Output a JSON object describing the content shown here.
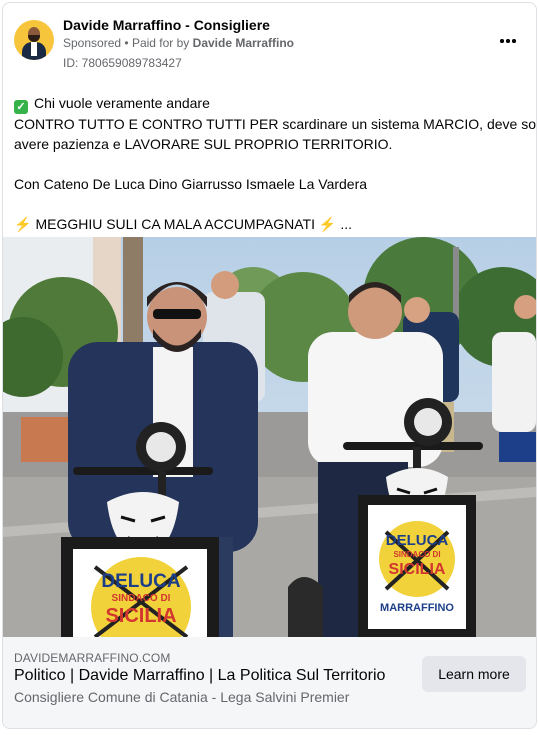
{
  "advertiser": {
    "name": "Davide Marraffino - Consigliere",
    "sponsored_label": "Sponsored",
    "paid_for_prefix": "Paid for by",
    "paid_for_name": "Davide Marraffino",
    "ad_id": "ID: 780659089783427"
  },
  "post": {
    "line1": "Chi vuole veramente andare",
    "line2": "CONTRO TUTTO E CONTRO TUTTI PER scardinare un sistema MARCIO, deve solo",
    "line3": "avere pazienza e LAVORARE SUL PROPRIO TERRITORIO.",
    "line4": "Con Cateno De Luca Dino Giarrusso Ismaele La Vardera",
    "line5": "MEGGHIU SULI CA MALA ACCUMPAGNATI",
    "line5_suffix": "..."
  },
  "image": {
    "left_sign_title": "DELUCA",
    "left_sign_sub1": "SINDACO DI",
    "left_sign_sub2": "SICILIA",
    "right_sign_title": "DELUCA",
    "right_sign_sub1": "SINDACO DI",
    "right_sign_sub2": "SICILIA",
    "right_sign_name": "MARRAFFINO"
  },
  "link": {
    "domain": "DAVIDEMARRAFFINO.COM",
    "headline": "Politico | Davide Marraffino | La Politica Sul Territorio",
    "description": "Consigliere Comune di Catania - Lega Salvini Premier",
    "cta_label": "Learn more"
  },
  "colors": {
    "check_green": "#35b34a",
    "bolt_orange": "#f39a2b",
    "sign_yellow": "#f2d23a",
    "footer_bg": "#f5f6f8"
  },
  "icons": {
    "more": "more-horizontal-icon",
    "check": "check-mark-button-icon",
    "bolt": "high-voltage-icon"
  }
}
